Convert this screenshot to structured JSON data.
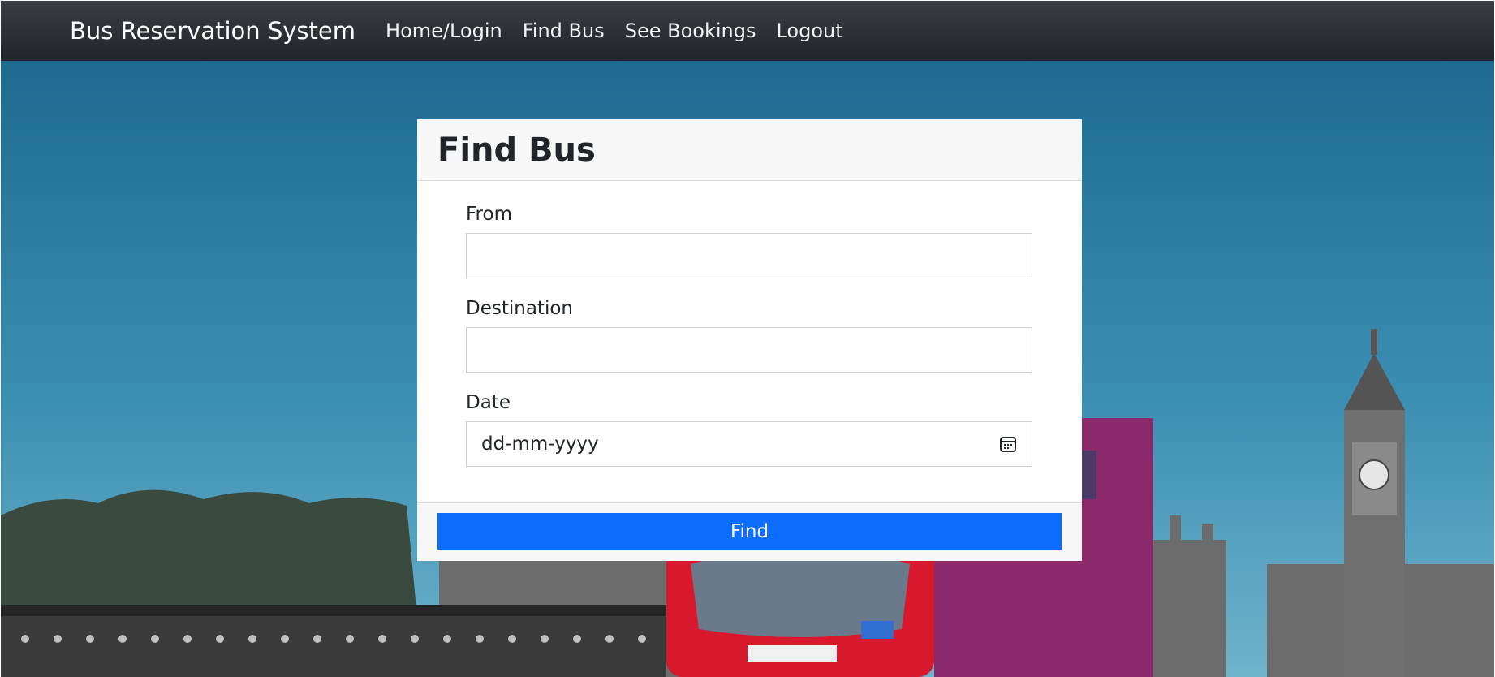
{
  "navbar": {
    "brand": "Bus Reservation System",
    "links": [
      "Home/Login",
      "Find Bus",
      "See Bookings",
      "Logout"
    ]
  },
  "card": {
    "title": "Find Bus",
    "fields": {
      "from_label": "From",
      "from_value": "",
      "destination_label": "Destination",
      "destination_value": "",
      "date_label": "Date",
      "date_placeholder": "dd-mm-yyyy"
    },
    "find_label": "Find"
  },
  "background": {
    "scene": "London street with red double-decker bus and clock tower",
    "sky_color": "#3f8fb0",
    "bus_color": "#d8182c"
  },
  "colors": {
    "navbar": "#2b2f33",
    "primary": "#0d6efd",
    "card_header": "#f7f7f7"
  }
}
